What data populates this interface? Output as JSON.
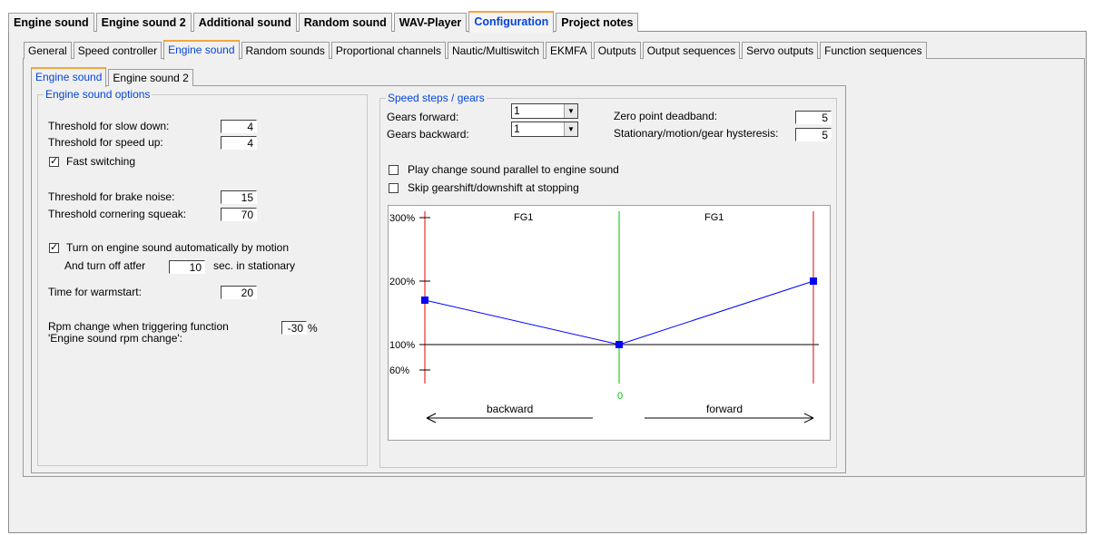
{
  "top_tabs": [
    "Engine sound",
    "Engine sound 2",
    "Additional sound",
    "Random sound",
    "WAV-Player",
    "Configuration",
    "Project notes"
  ],
  "sub_tabs": [
    "General",
    "Speed controller",
    "Engine sound",
    "Random sounds",
    "Proportional channels",
    "Nautic/Multiswitch",
    "EKMFA",
    "Outputs",
    "Output sequences",
    "Servo outputs",
    "Function sequences"
  ],
  "inner_tabs": [
    "Engine sound",
    "Engine sound 2"
  ],
  "options": {
    "legend": "Engine sound options",
    "slow_down_label": "Threshold for slow down:",
    "slow_down_value": "4",
    "speed_up_label": "Threshold for speed up:",
    "speed_up_value": "4",
    "fast_switching_label": "Fast switching",
    "fast_switching_checked": true,
    "brake_label": "Threshold for brake noise:",
    "brake_value": "15",
    "cornering_label": "Threshold cornering squeak:",
    "cornering_value": "70",
    "auto_on_label": "Turn on engine sound automatically by motion",
    "auto_on_checked": true,
    "turn_off_prefix": "And turn off atfer",
    "turn_off_value": "10",
    "turn_off_suffix": "sec. in stationary",
    "warmstart_label": "Time for warmstart:",
    "warmstart_value": "20",
    "rpm_label_1": "Rpm change when triggering function",
    "rpm_label_2": "'Engine sound rpm change':",
    "rpm_value": "-30",
    "rpm_unit": "%"
  },
  "speed": {
    "legend": "Speed steps / gears",
    "gears_forward_label": "Gears forward:",
    "gears_forward_value": "1",
    "gears_backward_label": "Gears backward:",
    "gears_backward_value": "1",
    "deadband_label": "Zero point deadband:",
    "deadband_value": "5",
    "hysteresis_label": "Stationary/motion/gear hysteresis:",
    "hysteresis_value": "5",
    "parallel_label": "Play change sound parallel to engine sound",
    "parallel_checked": false,
    "skip_label": "Skip gearshift/downshift at stopping",
    "skip_checked": false
  },
  "graph": {
    "y_labels": [
      "300%",
      "200%",
      "100%",
      "60%"
    ],
    "gear_left": "FG1",
    "gear_right": "FG1",
    "zero_label": "0",
    "backward_label": "backward",
    "forward_label": "forward",
    "points_percent": [
      170,
      100,
      200
    ],
    "colors": {
      "line": "#0000ff",
      "boundary": "#e00000",
      "zero": "#00c000",
      "baseline": "#000000"
    }
  }
}
